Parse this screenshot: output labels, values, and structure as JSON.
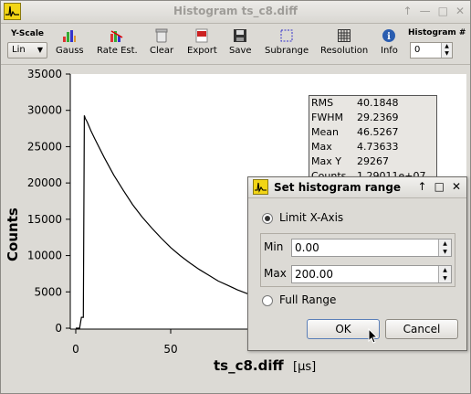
{
  "window": {
    "title": "Histogram ts_c8.diff",
    "controls": [
      "↑",
      "—",
      "□",
      "✕"
    ]
  },
  "toolbar": {
    "yscale_label": "Y-Scale",
    "yscale_value": "Lin",
    "histogram_label": "Histogram #",
    "histogram_value": "0",
    "items": [
      {
        "label": "Gauss",
        "icon": "gauss-icon"
      },
      {
        "label": "Rate Est.",
        "icon": "rate-estimate-icon"
      },
      {
        "label": "Clear",
        "icon": "clear-icon"
      },
      {
        "label": "Export",
        "icon": "export-icon"
      },
      {
        "label": "Save",
        "icon": "save-icon"
      },
      {
        "label": "Subrange",
        "icon": "subrange-icon"
      },
      {
        "label": "Resolution",
        "icon": "resolution-icon"
      },
      {
        "label": "Info",
        "icon": "info-icon"
      }
    ]
  },
  "stats": [
    {
      "key": "RMS",
      "value": "40.1848"
    },
    {
      "key": "FWHM",
      "value": "29.2369"
    },
    {
      "key": "Mean",
      "value": "46.5267"
    },
    {
      "key": "Max",
      "value": "4.73633"
    },
    {
      "key": "Max Y",
      "value": "29267"
    },
    {
      "key": "Counts",
      "value": "1.29011e+07"
    }
  ],
  "chart_data": {
    "type": "line",
    "xlabel": "ts_c8.diff",
    "xunit": "[μs]",
    "ylabel": "Counts",
    "xlim": [
      -2,
      205
    ],
    "ylim": [
      0,
      35000
    ],
    "x_ticks": [
      "0",
      "50"
    ],
    "y_ticks": [
      "0",
      "5000",
      "10000",
      "15000",
      "20000",
      "25000",
      "30000",
      "35000"
    ],
    "x": [
      0,
      2,
      3,
      4,
      4.5,
      5,
      6,
      8,
      10,
      15,
      20,
      25,
      30,
      35,
      40,
      45,
      50,
      55,
      60,
      65,
      70,
      75,
      80,
      85,
      90,
      95,
      100,
      110,
      115
    ],
    "y": [
      0,
      0,
      1500,
      1500,
      29300,
      28900,
      28400,
      27200,
      26100,
      23500,
      21100,
      19000,
      17000,
      15300,
      13800,
      12400,
      11100,
      10000,
      9000,
      8100,
      7300,
      6500,
      5900,
      5300,
      4800,
      4300,
      3900,
      3500,
      3300
    ]
  },
  "dialog": {
    "title": "Set histogram range",
    "controls": [
      "↑",
      "□",
      "✕"
    ],
    "limit_label": "Limit X-Axis",
    "min_label": "Min",
    "min_value": "0.00",
    "max_label": "Max",
    "max_value": "200.00",
    "full_label": "Full Range",
    "ok_label": "OK",
    "cancel_label": "Cancel"
  }
}
